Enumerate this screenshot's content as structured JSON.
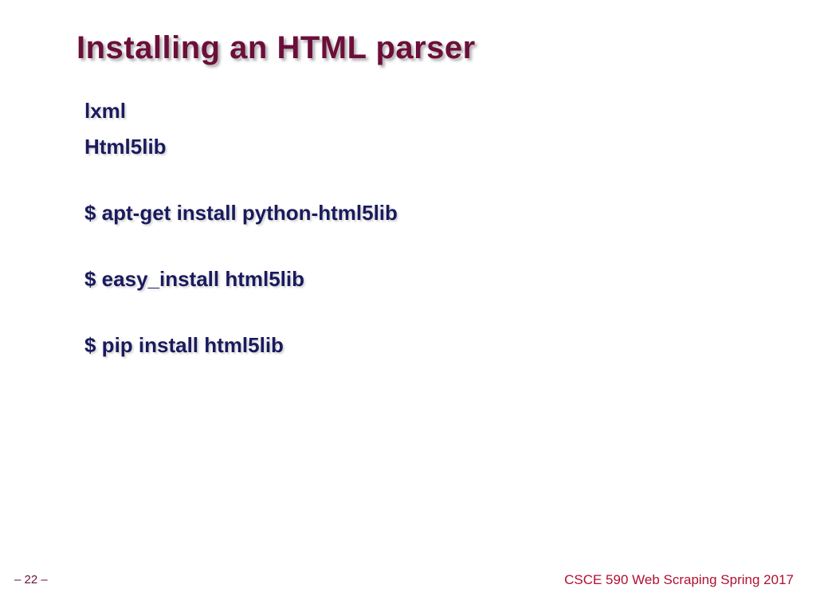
{
  "slide": {
    "title": "Installing an HTML  parser",
    "lines": {
      "line1": "lxml",
      "line2": "Html5lib",
      "line3": "$ apt-get install python-html5lib",
      "line4": "$ easy_install html5lib",
      "line5": "$ pip install html5lib"
    },
    "page_number": "– 22 –",
    "footer": "CSCE 590 Web Scraping Spring 2017"
  }
}
